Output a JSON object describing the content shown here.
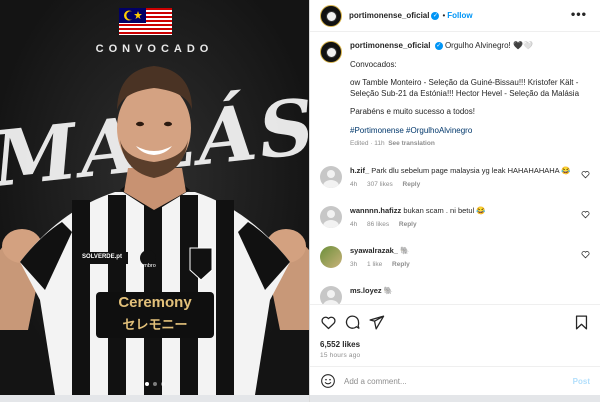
{
  "media": {
    "flag_country": "Malaysia",
    "headline": "CONVOCADO",
    "country_text": "MALÁSIA",
    "sponsor_sleeve": "SOLVERDE.pt",
    "kit_brand": "umbro",
    "sponsor_main": "Ceremony",
    "sponsor_sub": "セレモニー",
    "slides": {
      "count": 3,
      "active_index": 0
    }
  },
  "post": {
    "username": "portimonense_oficial",
    "verified_glyph": "✓",
    "separator": "•",
    "follow_label": "Follow",
    "more_label": "•••",
    "caption": {
      "username": "portimonense_oficial",
      "headline": "Orgulho Alvinegro! 🖤🤍",
      "line_title": "Convocados:",
      "line_players": "ow Tamble Monteiro - Seleção da Guiné-Bissau!!! Kristofer Kält - Seleção Sub-21 da Estónia!!! Hector Hevel - Seleção da Malásia",
      "line_congrats": "Parabéns e muito sucesso a todos!",
      "hashtags": "#Portimonense #OrgulhoAlvinegro",
      "edited": "Edited · 11h",
      "see_translation": "See translation"
    },
    "comments": [
      {
        "user": "h.zif_",
        "text": "Park dlu sebelum page malaysia yg leak HAHAHAHAHA 😂",
        "time": "4h",
        "likes": "307 likes",
        "reply": "Reply",
        "avatar": "default"
      },
      {
        "user": "wannnn.hafizz",
        "text": "bukan scam . ni betul 😂",
        "time": "4h",
        "likes": "86 likes",
        "reply": "Reply",
        "avatar": "default"
      },
      {
        "user": "syawalrazak_",
        "text": "🐘",
        "time": "3h",
        "likes": "1 like",
        "reply": "Reply",
        "avatar": "photo"
      },
      {
        "user": "ms.loyez",
        "text": "🐘",
        "time": "",
        "likes": "",
        "reply": "",
        "avatar": "default"
      }
    ],
    "likes_count": "6,552 likes",
    "time_ago": "15 hours ago",
    "add_comment_placeholder": "Add a comment...",
    "post_label": "Post"
  },
  "icons": {
    "heart": "heart-icon",
    "comment": "comment-icon",
    "share": "share-icon",
    "save": "bookmark-icon",
    "emoji": "emoji-icon",
    "more": "more-icon"
  },
  "colors": {
    "accent_blue": "#0095f6",
    "muted_gray": "#8e8e8e",
    "border": "#dbdbdb",
    "post_disabled": "#b2dffc",
    "media_bg": "#1b1b1b"
  }
}
